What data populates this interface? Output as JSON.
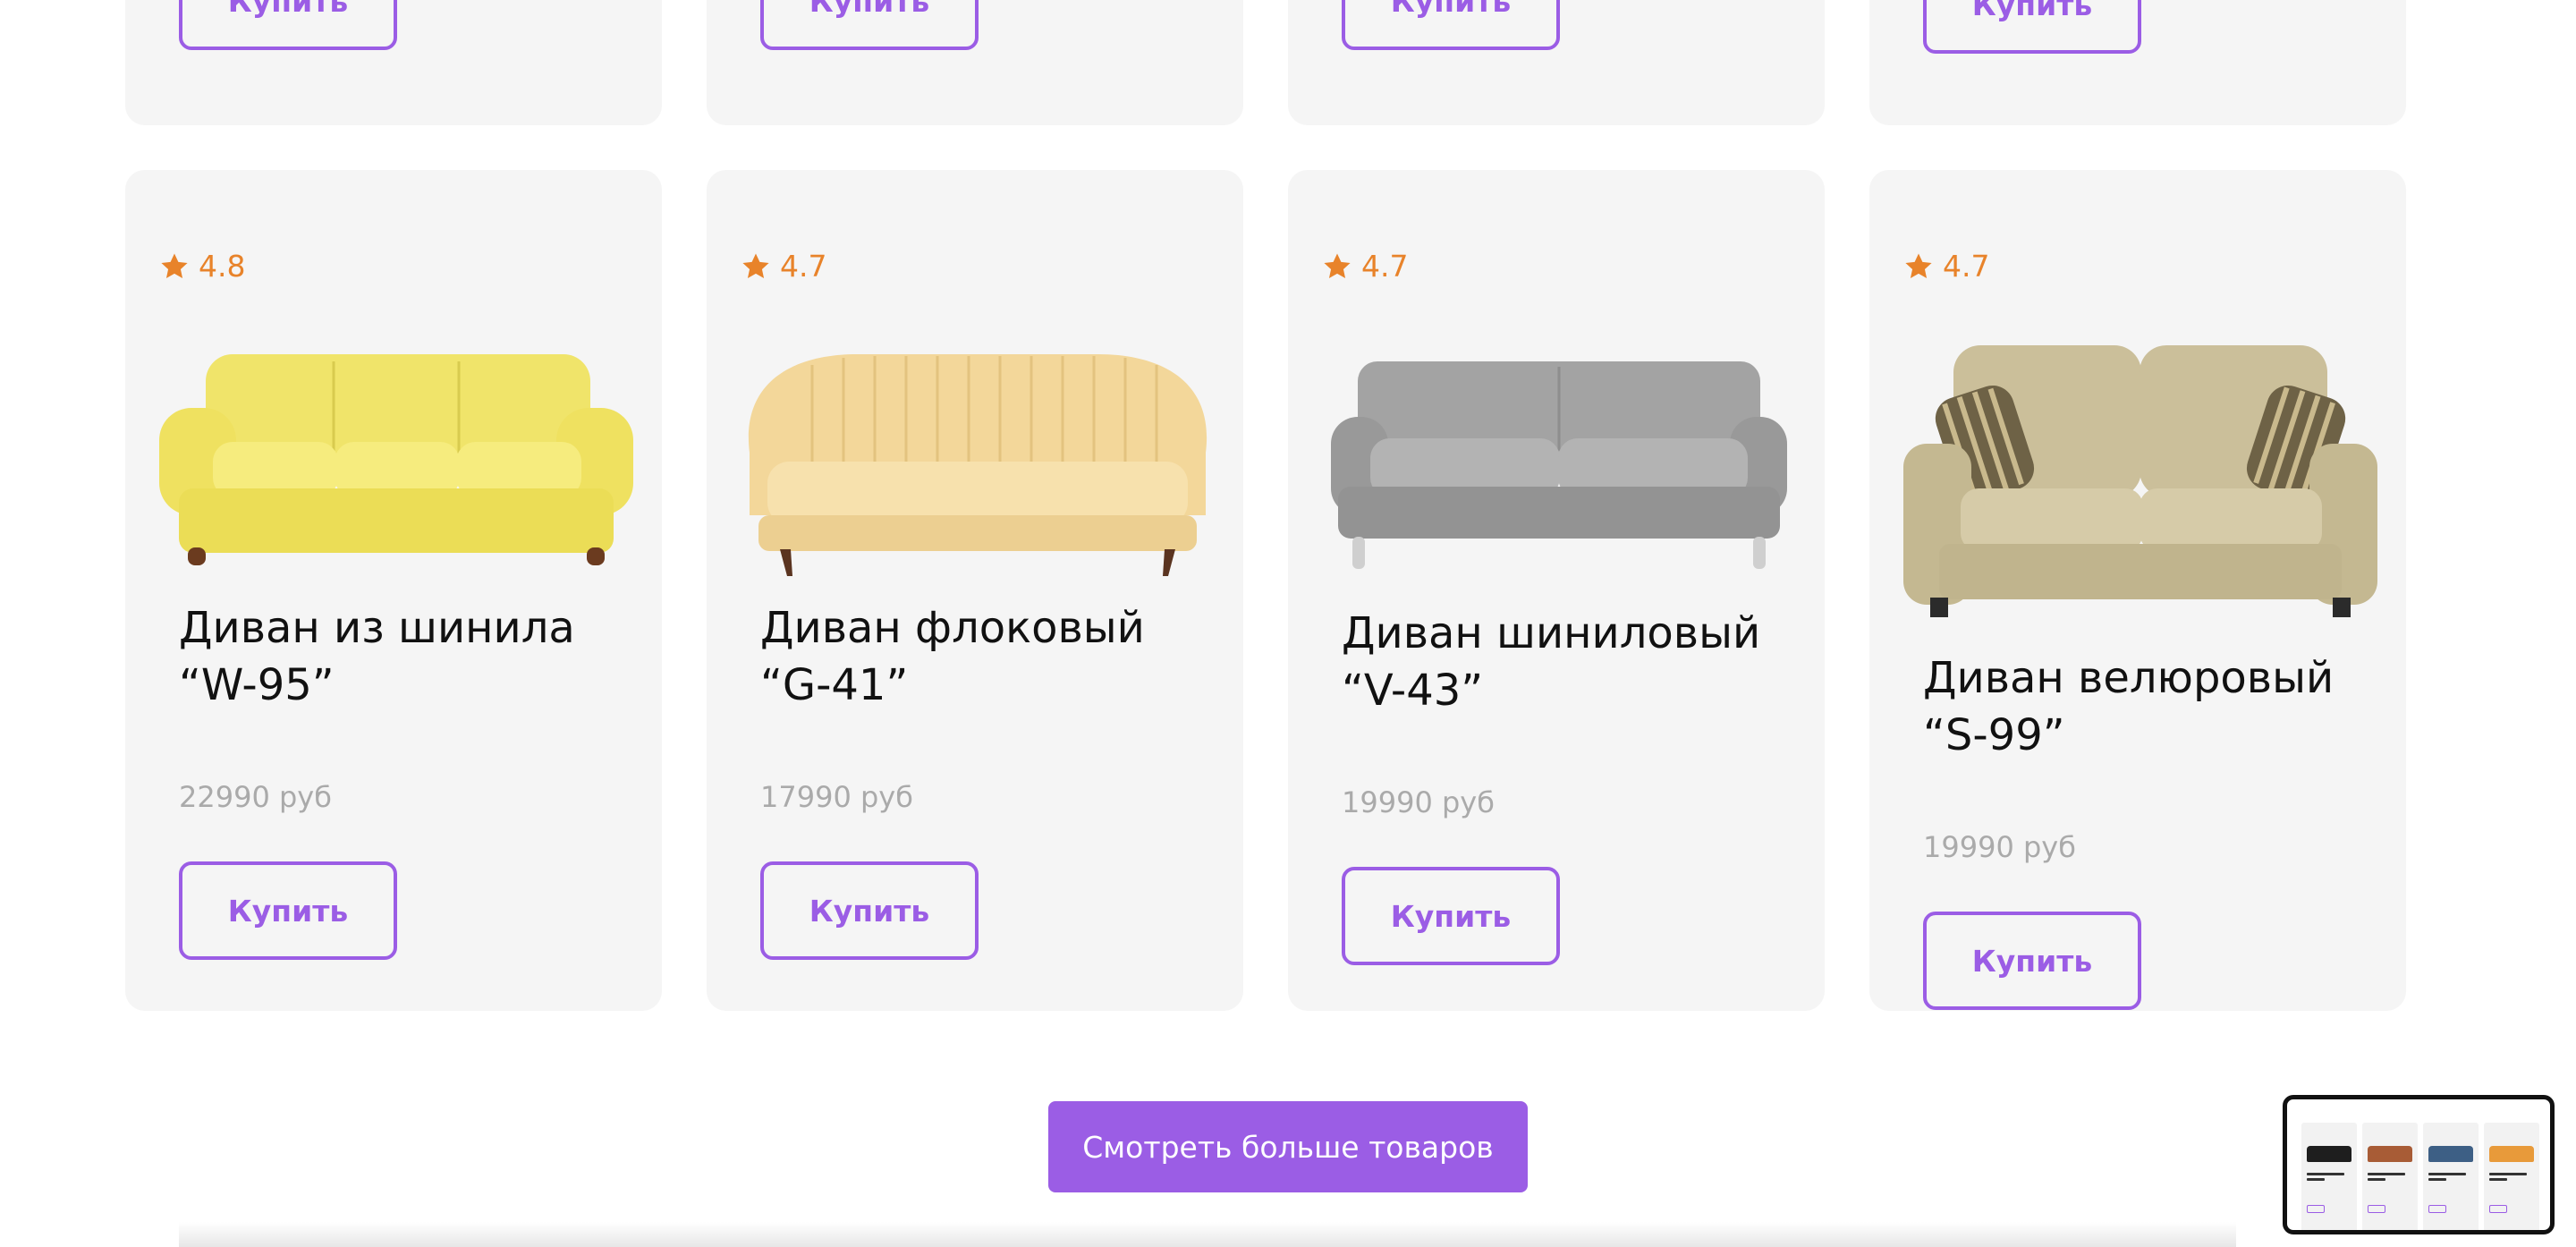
{
  "top_row": {
    "buy_labels": [
      "Купить",
      "Купить",
      "Купить",
      "Купить"
    ]
  },
  "products": [
    {
      "rating": "4.8",
      "title": "Диван из шинила “W-95”",
      "price": "22990 руб",
      "buy_label": "Купить",
      "sofa_color": "#f1e56a"
    },
    {
      "rating": "4.7",
      "title": "Диван флоковый “G-41”",
      "price": "17990 руб",
      "buy_label": "Купить",
      "sofa_color": "#f3d9a0"
    },
    {
      "rating": "4.7",
      "title": "Диван шиниловый “V-43”",
      "price": "19990 руб",
      "buy_label": "Купить",
      "sofa_color": "#9b9b9b"
    },
    {
      "rating": "4.7",
      "title": "Диван велюровый “S-99”",
      "price": "19990 руб",
      "buy_label": "Купить",
      "sofa_color": "#c9bd98"
    }
  ],
  "more_button": {
    "label": "Смотреть больше товаров"
  },
  "colors": {
    "accent": "#9b5de5",
    "rating": "#e8832a",
    "card_bg": "#f5f5f5",
    "price": "#aaaaaa"
  },
  "icons": {
    "rating": "star-icon"
  }
}
